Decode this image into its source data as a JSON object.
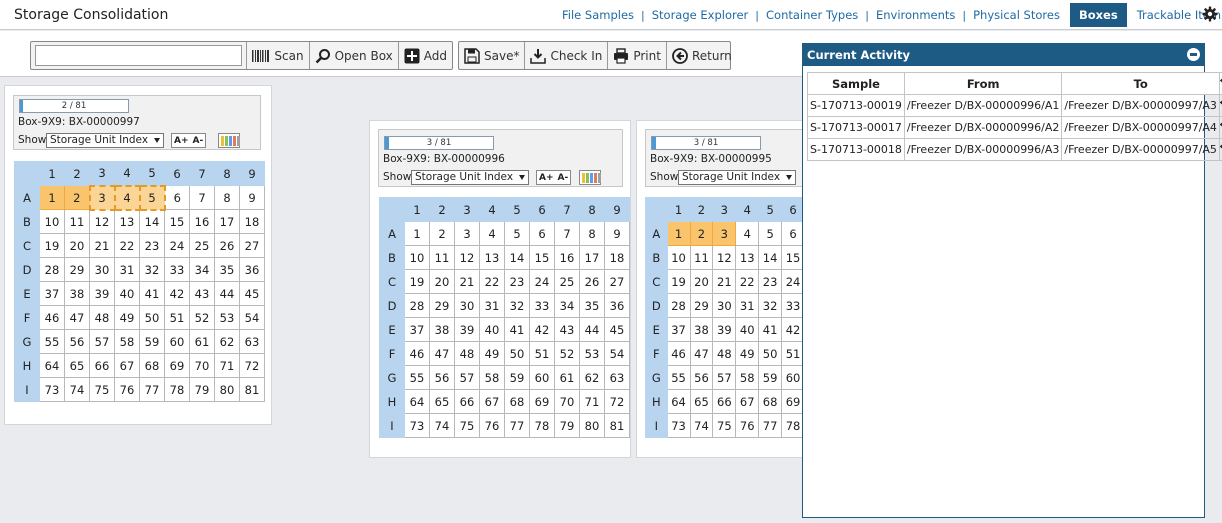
{
  "app": {
    "title": "Storage Consolidation"
  },
  "nav": {
    "items": [
      "File Samples",
      "Storage Explorer",
      "Container Types",
      "Environments",
      "Physical Stores",
      "Boxes",
      "Trackable Item..."
    ],
    "active": "Boxes"
  },
  "toolbar": {
    "scan_input": {
      "value": "",
      "placeholder": ""
    },
    "scan_label": "Scan",
    "open_box_label": "Open Box",
    "add_label": "Add",
    "save_label": "Save*",
    "check_in_label": "Check In",
    "print_label": "Print",
    "return_label": "Return"
  },
  "boxes": [
    {
      "progress_text": "2 / 81",
      "progress_fraction": 0.025,
      "title": "Box-9X9: BX-00000997",
      "show_label": "Show",
      "show_value": "Storage Unit Index",
      "font_up": "A+",
      "font_down": "A-",
      "columns": [
        "1",
        "2",
        "3",
        "4",
        "5",
        "6",
        "7",
        "8",
        "9"
      ],
      "rows": [
        "A",
        "B",
        "C",
        "D",
        "E",
        "F",
        "G",
        "H",
        "I"
      ],
      "selected": [
        1,
        2
      ],
      "pending": [
        3,
        4,
        5
      ]
    },
    {
      "progress_text": "3 / 81",
      "progress_fraction": 0.037,
      "title": "Box-9X9: BX-00000996",
      "show_label": "Show",
      "show_value": "Storage Unit Index",
      "font_up": "A+",
      "font_down": "A-",
      "columns": [
        "1",
        "2",
        "3",
        "4",
        "5",
        "6",
        "7",
        "8",
        "9"
      ],
      "rows": [
        "A",
        "B",
        "C",
        "D",
        "E",
        "F",
        "G",
        "H",
        "I"
      ],
      "selected": [],
      "pending": []
    },
    {
      "progress_text": "3 / 81",
      "progress_fraction": 0.037,
      "title": "Box-9X9: BX-00000995",
      "show_label": "Show",
      "show_value": "Storage Unit Index",
      "font_up": "A+",
      "font_down": "A-",
      "columns": [
        "1",
        "2",
        "3",
        "4",
        "5",
        "6"
      ],
      "rows": [
        "A",
        "B",
        "C",
        "D",
        "E",
        "F",
        "G",
        "H",
        "I"
      ],
      "selected": [
        1,
        2,
        3
      ],
      "pending": []
    }
  ],
  "activity": {
    "title": "Current Activity",
    "headers": [
      "Sample",
      "From",
      "To"
    ],
    "rows": [
      {
        "sample": "S-170713-00019",
        "from": "/Freezer D/BX-00000996/A1",
        "to": "/Freezer D/BX-00000997/A3"
      },
      {
        "sample": "S-170713-00017",
        "from": "/Freezer D/BX-00000996/A2",
        "to": "/Freezer D/BX-00000997/A4"
      },
      {
        "sample": "S-170713-00018",
        "from": "/Freezer D/BX-00000996/A3",
        "to": "/Freezer D/BX-00000997/A5"
      }
    ]
  },
  "colors": {
    "nav_active": "#1d5b85",
    "grid_header": "#b8d4ee",
    "selected_cell": "#f9c46b",
    "link": "#1f6aa5"
  }
}
